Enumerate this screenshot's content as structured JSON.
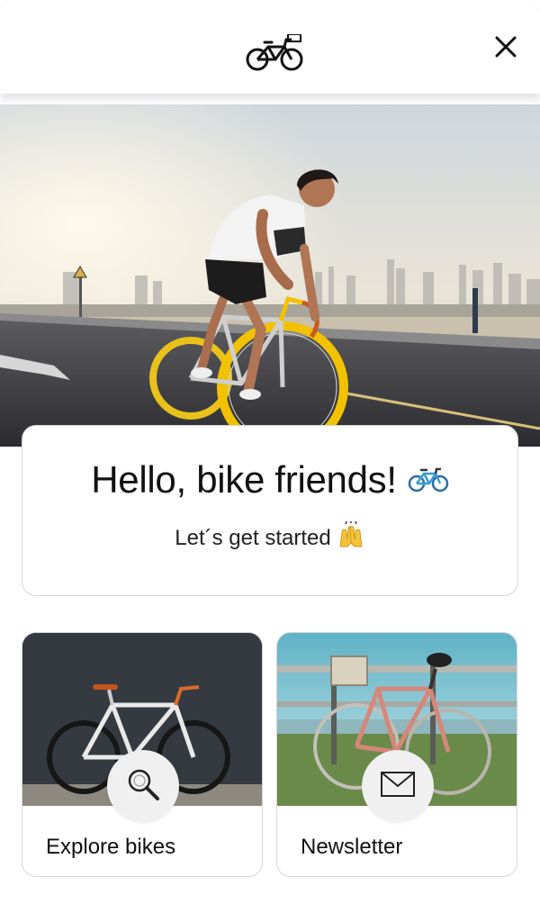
{
  "header": {
    "logo_icon": "bicycle-icon",
    "close_icon": "close-icon"
  },
  "hero": {
    "image_subject": "cyclist-on-yellow-wheel-bike-road"
  },
  "greeting": {
    "title": "Hello, bike friends!",
    "title_emoji": "🚲",
    "subtitle": "Let´s get started",
    "subtitle_emoji": "🙌"
  },
  "tiles": [
    {
      "label": "Explore bikes",
      "icon": "search-icon"
    },
    {
      "label": "Newsletter",
      "icon": "envelope-icon"
    }
  ],
  "colors": {
    "accent_yellow": "#f2c200",
    "card_border": "#d6d6d6",
    "circle_bg": "#f0f0f0"
  }
}
